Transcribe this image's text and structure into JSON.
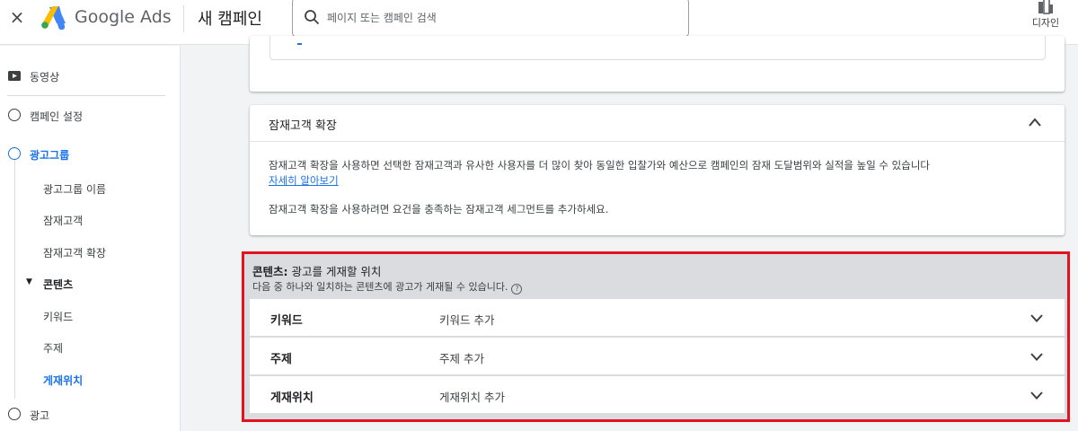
{
  "header": {
    "close_icon": "×",
    "brand": "Google Ads",
    "campaign_title": "새 캠페인",
    "search_placeholder": "페이지 또는 캠페인 검색",
    "design_label": "디자인"
  },
  "sidebar": {
    "video": "동영상",
    "campaign_settings": "캠페인 설정",
    "ad_group": "광고그룹",
    "sub_items": [
      "광고그룹 이름",
      "잠재고객",
      "잠재고객 확장"
    ],
    "content": "콘텐츠",
    "content_items": [
      "키워드",
      "주제",
      "게재위치"
    ],
    "ad": "광고"
  },
  "audience_expansion": {
    "title": "잠재고객 확장",
    "description": "잠재고객 확장을 사용하면 선택한 잠재고객과 유사한 사용자를 더 많이 찾아 동일한 입찰가와 예산으로 캠페인의 잠재 도달범위와 실적을 높일 수 있습니다",
    "learn_more": "자세히 알아보기",
    "note": "잠재고객 확장을 사용하려면 요건을 충족하는 잠재고객 세그먼트를 추가하세요."
  },
  "content_section": {
    "title_bold": "콘텐츠:",
    "title_rest": " 광고를 게재할 위치",
    "subtitle": "다음 중 하나와 일치하는 콘텐츠에 광고가 게재될 수 있습니다.",
    "help": "?",
    "rows": [
      {
        "label": "키워드",
        "value": "키워드 추가"
      },
      {
        "label": "주제",
        "value": "주제 추가"
      },
      {
        "label": "게재위치",
        "value": "게재위치 추가"
      }
    ]
  },
  "colors": {
    "accent": "#1a73e8",
    "highlight_border": "#e3121c",
    "section_bg": "#dadce0"
  }
}
